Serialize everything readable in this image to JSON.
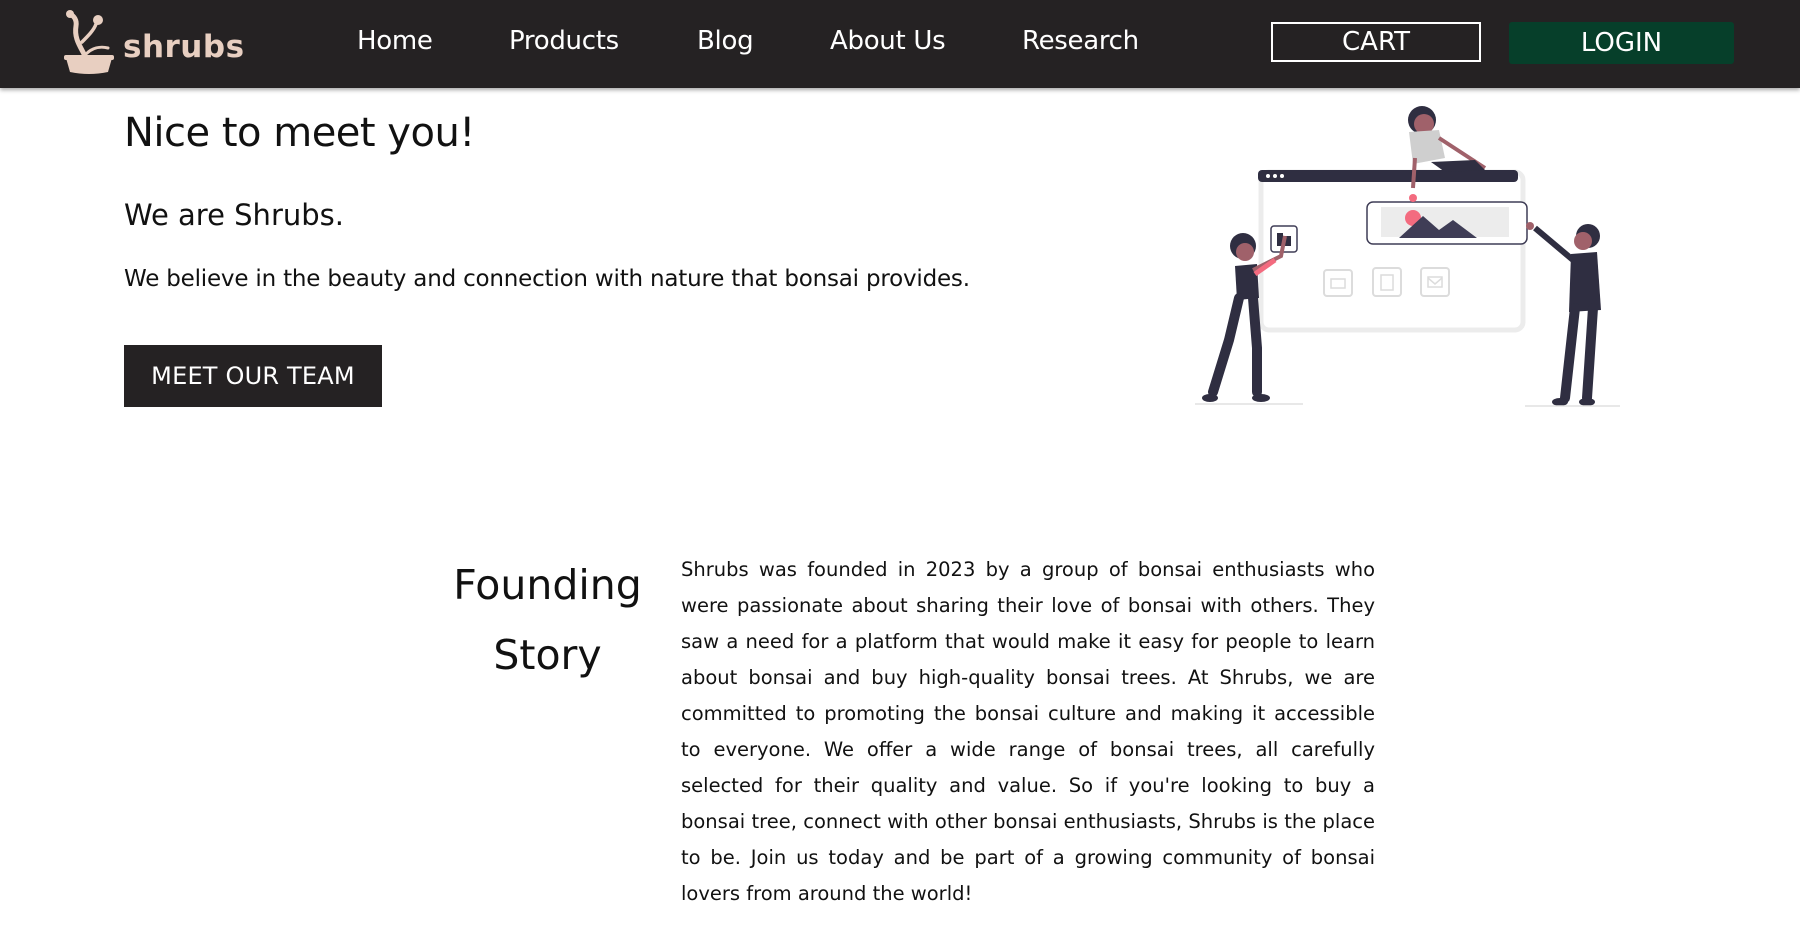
{
  "brand": {
    "name": "shrubs"
  },
  "nav": {
    "links": [
      "Home",
      "Products",
      "Blog",
      "About Us",
      "Research"
    ],
    "cart_label": "CART",
    "login_label": "LOGIN"
  },
  "hero": {
    "heading": "Nice to meet you!",
    "subheading": "We are Shrubs.",
    "tagline": "We believe in the beauty and connection with nature that bonsai provides.",
    "cta_label": "MEET OUR TEAM"
  },
  "founding": {
    "title": "Founding Story",
    "body": "Shrubs was founded in 2023 by a group of bonsai enthusiasts who were passionate about sharing their love of bonsai with others. They saw a need for a platform that would make it easy for people to learn about bonsai and buy high-quality bonsai trees. At Shrubs, we are committed to promoting the bonsai culture and making it accessible to everyone. We offer a wide range of bonsai trees, all carefully selected for their quality and value. So if you're looking to buy a bonsai tree, connect with other bonsai enthusiasts, Shrubs is the place to be. Join us today and be part of a growing community of bonsai lovers from around the world!"
  },
  "colors": {
    "nav_bg": "#252223",
    "brand_text": "#e8cfc1",
    "login_bg": "#063f2a",
    "cta_bg": "#252223",
    "illustration_accent": "#f36b7f"
  },
  "icons": [
    "bonsai-logo-icon",
    "folder-icon",
    "image-icon",
    "document-icon",
    "mail-icon"
  ]
}
